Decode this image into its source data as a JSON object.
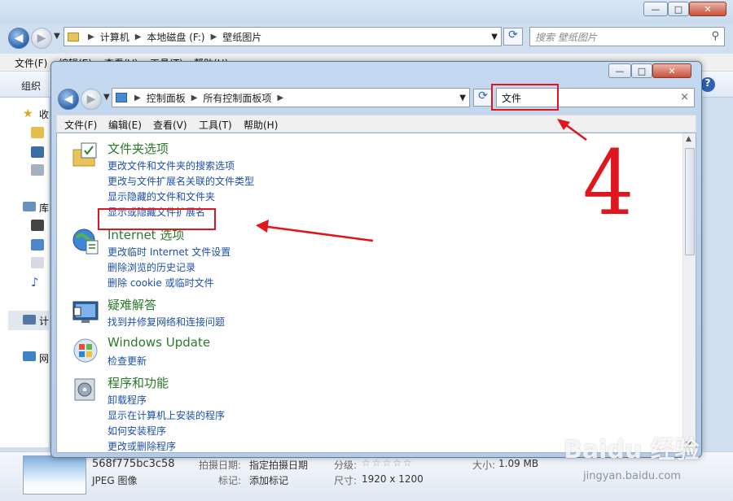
{
  "background_window": {
    "address": {
      "crumbs": [
        "计算机",
        "本地磁盘 (F:)",
        "壁纸图片"
      ]
    },
    "search_placeholder": "搜索 壁纸图片",
    "menu": [
      "文件(F)",
      "编辑(E)",
      "查看(V)",
      "工具(T)",
      "帮助(H)"
    ],
    "toolbar": {
      "organize": "组织"
    },
    "sidebar": {
      "favorites": "收",
      "libraries": "库",
      "computer": "计",
      "network": "网"
    },
    "details": {
      "filename": "568f775bc3c58",
      "filetype": "JPEG 图像",
      "date_key": "拍摄日期:",
      "date_value": "指定拍摄日期",
      "tags_key": "标记:",
      "tags_value": "添加标记",
      "rating_key": "分级:",
      "rating_value": "☆☆☆☆☆",
      "dims_key": "尺寸:",
      "dims_value": "1920 x 1200",
      "size_key": "大小:",
      "size_value": "1.09 MB"
    }
  },
  "control_panel": {
    "address": {
      "crumbs": [
        "控制面板",
        "所有控制面板项"
      ]
    },
    "search_value": "文件",
    "search_clear": "×",
    "menu": [
      "文件(F)",
      "编辑(E)",
      "查看(V)",
      "工具(T)",
      "帮助(H)"
    ],
    "sections": [
      {
        "title": "文件夹选项",
        "icon": "folder-options-icon",
        "links": [
          "更改文件和文件夹的搜索选项",
          "更改与文件扩展名关联的文件类型",
          "显示隐藏的文件和文件夹",
          "显示或隐藏文件扩展名"
        ]
      },
      {
        "title": "Internet 选项",
        "icon": "internet-options-icon",
        "links": [
          "更改临时 Internet 文件设置",
          "删除浏览的历史记录",
          "删除 cookie 或临时文件"
        ]
      },
      {
        "title": "疑难解答",
        "icon": "troubleshooting-icon",
        "links": [
          "找到并修复网络和连接问题"
        ]
      },
      {
        "title": "Windows Update",
        "icon": "windows-update-icon",
        "links": [
          "检查更新"
        ]
      },
      {
        "title": "程序和功能",
        "icon": "programs-features-icon",
        "links": [
          "卸载程序",
          "显示在计算机上安装的程序",
          "如何安装程序",
          "更改或删除程序"
        ]
      }
    ]
  },
  "annotation": {
    "step_number": "4",
    "color": "#e0161f"
  },
  "watermark": {
    "logo": "Baidu 经验",
    "url": "jingyan.baidu.com"
  }
}
